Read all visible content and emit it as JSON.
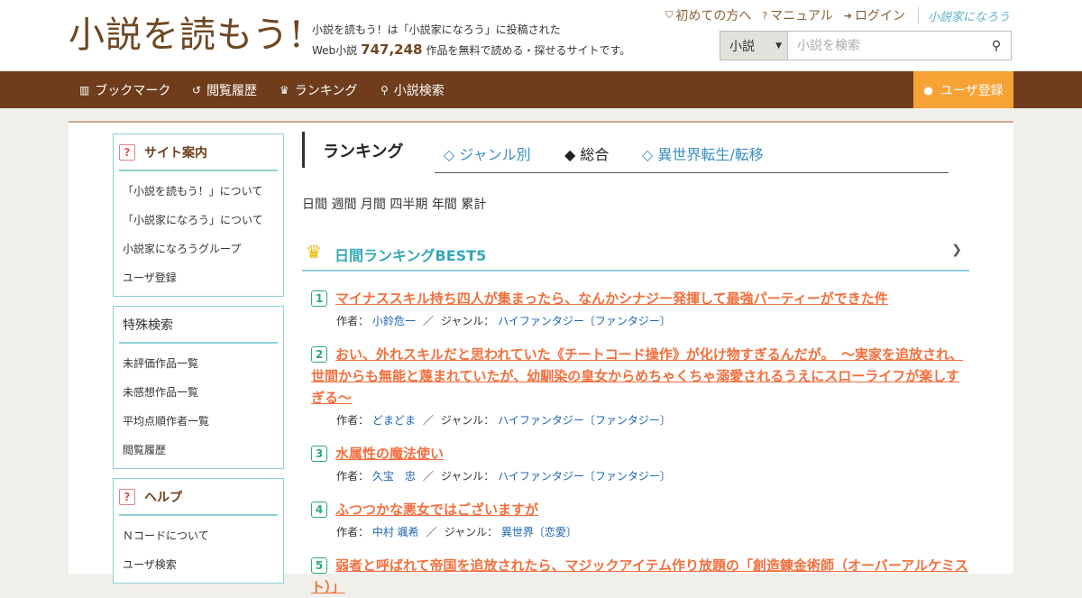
{
  "header": {
    "logo": "小説を読もう!",
    "tagline_line1": "小説を読もう！は「小説家になろう」に投稿された",
    "tagline_prefix": "Web小説",
    "work_count": "747,248",
    "tagline_suffix": "作品を無料で読める・探せるサイトです。",
    "links": [
      {
        "icon": "shield-icon",
        "glyph": "⛉",
        "label": "初めての方へ"
      },
      {
        "icon": "help-icon",
        "glyph": "?",
        "label": "マニュアル"
      },
      {
        "icon": "login-icon",
        "glyph": "➜",
        "label": "ログイン"
      }
    ],
    "brand": "小説家になろう",
    "search": {
      "category": "小説",
      "placeholder": "小説を検索"
    }
  },
  "nav": {
    "items": [
      {
        "glyph": "▥",
        "label": "ブックマーク"
      },
      {
        "glyph": "↺",
        "label": "閲覧履歴"
      },
      {
        "glyph": "♛",
        "label": "ランキング"
      },
      {
        "glyph": "⚲",
        "label": "小説検索"
      }
    ],
    "register": "ユーザ登録"
  },
  "sidebar": {
    "guide": {
      "title": "サイト案内",
      "items": [
        "「小説を読もう！」について",
        "「小説家になろう」について",
        "小説家になろうグループ",
        "ユーザ登録"
      ]
    },
    "special": {
      "title": "特殊検索",
      "items": [
        "未評価作品一覧",
        "未感想作品一覧",
        "平均点順作者一覧",
        "閲覧履歴"
      ]
    },
    "help": {
      "title": "ヘルプ",
      "items": [
        "Ｎコードについて",
        "ユーザ検索"
      ]
    }
  },
  "ranking": {
    "title": "ランキング",
    "tabs": [
      {
        "label": "◇ ジャンル別"
      },
      {
        "label": "◆ 総合"
      },
      {
        "label": "◇ 異世界転生/転移"
      }
    ],
    "periods": [
      "日間",
      "週間",
      "月間",
      "四半期",
      "年間",
      "累計"
    ],
    "best_title": "日間ランキングBEST5",
    "author_label": "作者：",
    "genre_label": "ジャンル：",
    "entries": [
      {
        "rank": "1",
        "title": "マイナススキル持ち四人が集まったら、なんかシナジー発揮して最強パーティーができた件",
        "author": "小鈴危一",
        "genre": "ハイファンタジー〔ファンタジー〕"
      },
      {
        "rank": "2",
        "title": "おい、外れスキルだと思われていた《チートコード操作》が化け物すぎるんだが。　〜実家を追放され、世間からも無能と蔑まれていたが、幼馴染の皇女からめちゃくちゃ溺愛されるうえにスローライフが楽しすぎる〜",
        "author": "どまどま",
        "genre": "ハイファンタジー〔ファンタジー〕"
      },
      {
        "rank": "3",
        "title": "水属性の魔法使い",
        "author": "久宝　忠",
        "genre": "ハイファンタジー〔ファンタジー〕"
      },
      {
        "rank": "4",
        "title": "ふつつかな悪女ではございますが",
        "author": "中村 颯希",
        "genre": "異世界〔恋愛〕"
      },
      {
        "rank": "5",
        "title": "弱者と呼ばれて帝国を追放されたら、マジックアイテム作り放題の「創造錬金術師（オーバーアルケミスト）」",
        "author": "",
        "genre": ""
      }
    ]
  }
}
